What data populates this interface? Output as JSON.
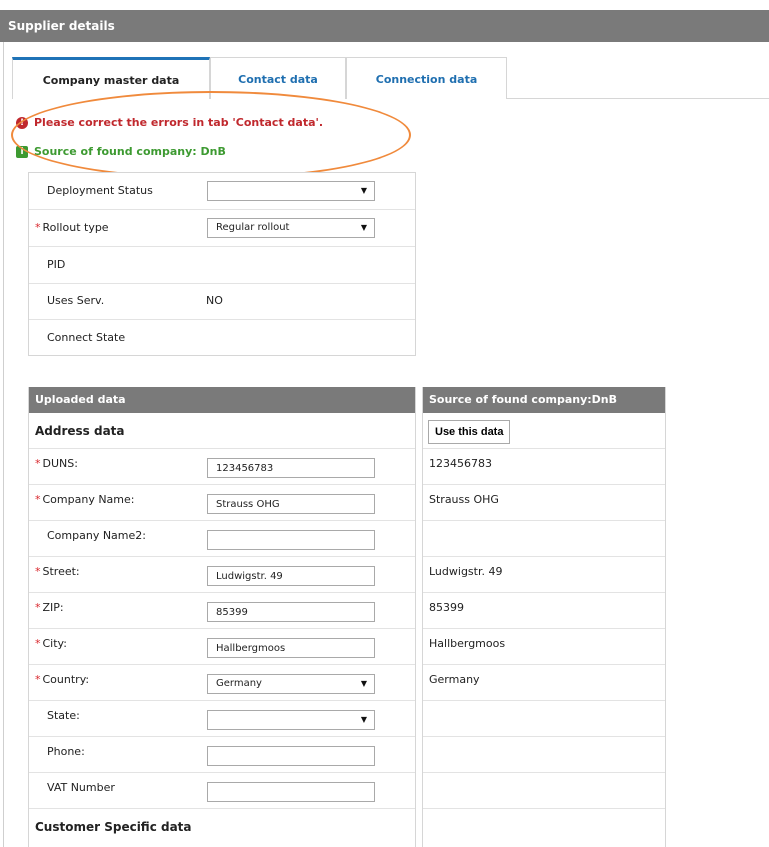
{
  "header": {
    "title": "Supplier details"
  },
  "tabs": [
    {
      "label": "Company master data"
    },
    {
      "label": "Contact data"
    },
    {
      "label": "Connection data"
    }
  ],
  "messages": {
    "error": "Please correct the errors in tab 'Contact data'.",
    "success": "Source of found company: DnB"
  },
  "status": {
    "deployment_label": "Deployment Status",
    "deployment_value": "",
    "rollout_label": "Rollout type",
    "rollout_value": "Regular rollout",
    "pid_label": "PID",
    "uses_label": "Uses Serv.",
    "uses_value": "NO",
    "connect_label": "Connect State"
  },
  "uploaded": {
    "header": "Uploaded data",
    "address_title": "Address data",
    "fields": [
      {
        "label": "DUNS:",
        "value": "123456783"
      },
      {
        "label": "Company Name:",
        "value": "Strauss OHG"
      },
      {
        "label": "Company Name2:",
        "value": ""
      },
      {
        "label": "Street:",
        "value": "Ludwigstr. 49"
      },
      {
        "label": "ZIP:",
        "value": "85399"
      },
      {
        "label": "City:",
        "value": "Hallbergmoos"
      },
      {
        "label": "Country:",
        "value": "Germany"
      },
      {
        "label": "State:",
        "value": ""
      },
      {
        "label": "Phone:",
        "value": ""
      },
      {
        "label": "VAT Number",
        "value": ""
      }
    ],
    "customer_title": "Customer Specific data"
  },
  "source": {
    "header": "Source of found company:DnB",
    "use_button": "Use this data",
    "values": [
      "123456783",
      "Strauss OHG",
      "",
      "Ludwigstr. 49",
      "85399",
      "Hallbergmoos",
      "Germany",
      "",
      "",
      ""
    ]
  },
  "colors": {
    "accent": "#1f73b7",
    "error": "#c0282d",
    "success": "#3d9a31",
    "required": "#d9262c",
    "highlight": "#f08a3c",
    "header_bg": "#7a7a7a"
  }
}
